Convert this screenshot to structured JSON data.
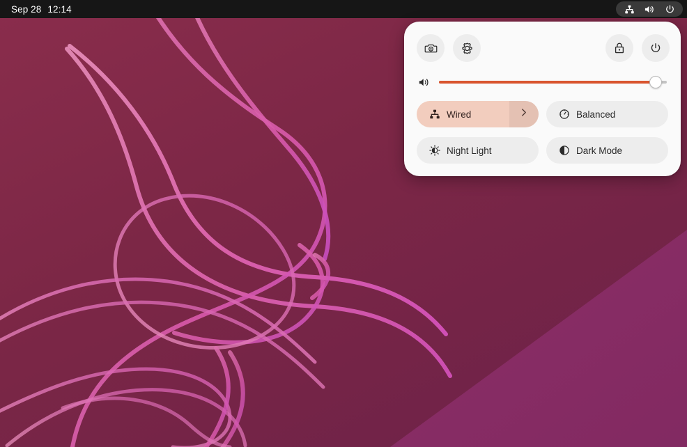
{
  "topbar": {
    "date": "Sep 28",
    "time": "12:14",
    "indicators": [
      {
        "name": "network-wired-icon",
        "label": "Wired Network"
      },
      {
        "name": "volume-icon",
        "label": "Volume"
      },
      {
        "name": "power-icon",
        "label": "System"
      }
    ]
  },
  "quick_settings": {
    "buttons": [
      {
        "name": "screenshot-button",
        "label": "Take Screenshot",
        "icon": "camera-icon"
      },
      {
        "name": "settings-button",
        "label": "Settings",
        "icon": "gear-icon"
      },
      {
        "name": "lock-button",
        "label": "Lock Screen",
        "icon": "lock-icon"
      },
      {
        "name": "power-button",
        "label": "Power Off / Log Out",
        "icon": "power-icon"
      }
    ],
    "volume": {
      "label": "Volume",
      "icon": "speaker-icon",
      "value": 95,
      "min": 0,
      "max": 100
    },
    "tiles": [
      {
        "name": "tile-wired",
        "label": "Wired",
        "icon": "network-wired-icon",
        "active": true,
        "has_arrow": true
      },
      {
        "name": "tile-balanced",
        "label": "Balanced",
        "icon": "speedometer-icon",
        "active": false,
        "has_arrow": false
      },
      {
        "name": "tile-night-light",
        "label": "Night Light",
        "icon": "sun-icon",
        "active": false,
        "has_arrow": false
      },
      {
        "name": "tile-dark-mode",
        "label": "Dark Mode",
        "icon": "half-circle-icon",
        "active": false,
        "has_arrow": false
      }
    ]
  },
  "colors": {
    "accent": "#d9552f",
    "panel_bg": "#fafafa",
    "tile_bg": "#ededed",
    "tile_active_bg": "#f2cdbe",
    "topbar_bg": "#161616",
    "wallpaper_dark": "#7a2745",
    "wallpaper_light": "#8a2d66",
    "ribbon_pink": "#e06ab0",
    "ribbon_pink_light": "#e58bb4"
  }
}
